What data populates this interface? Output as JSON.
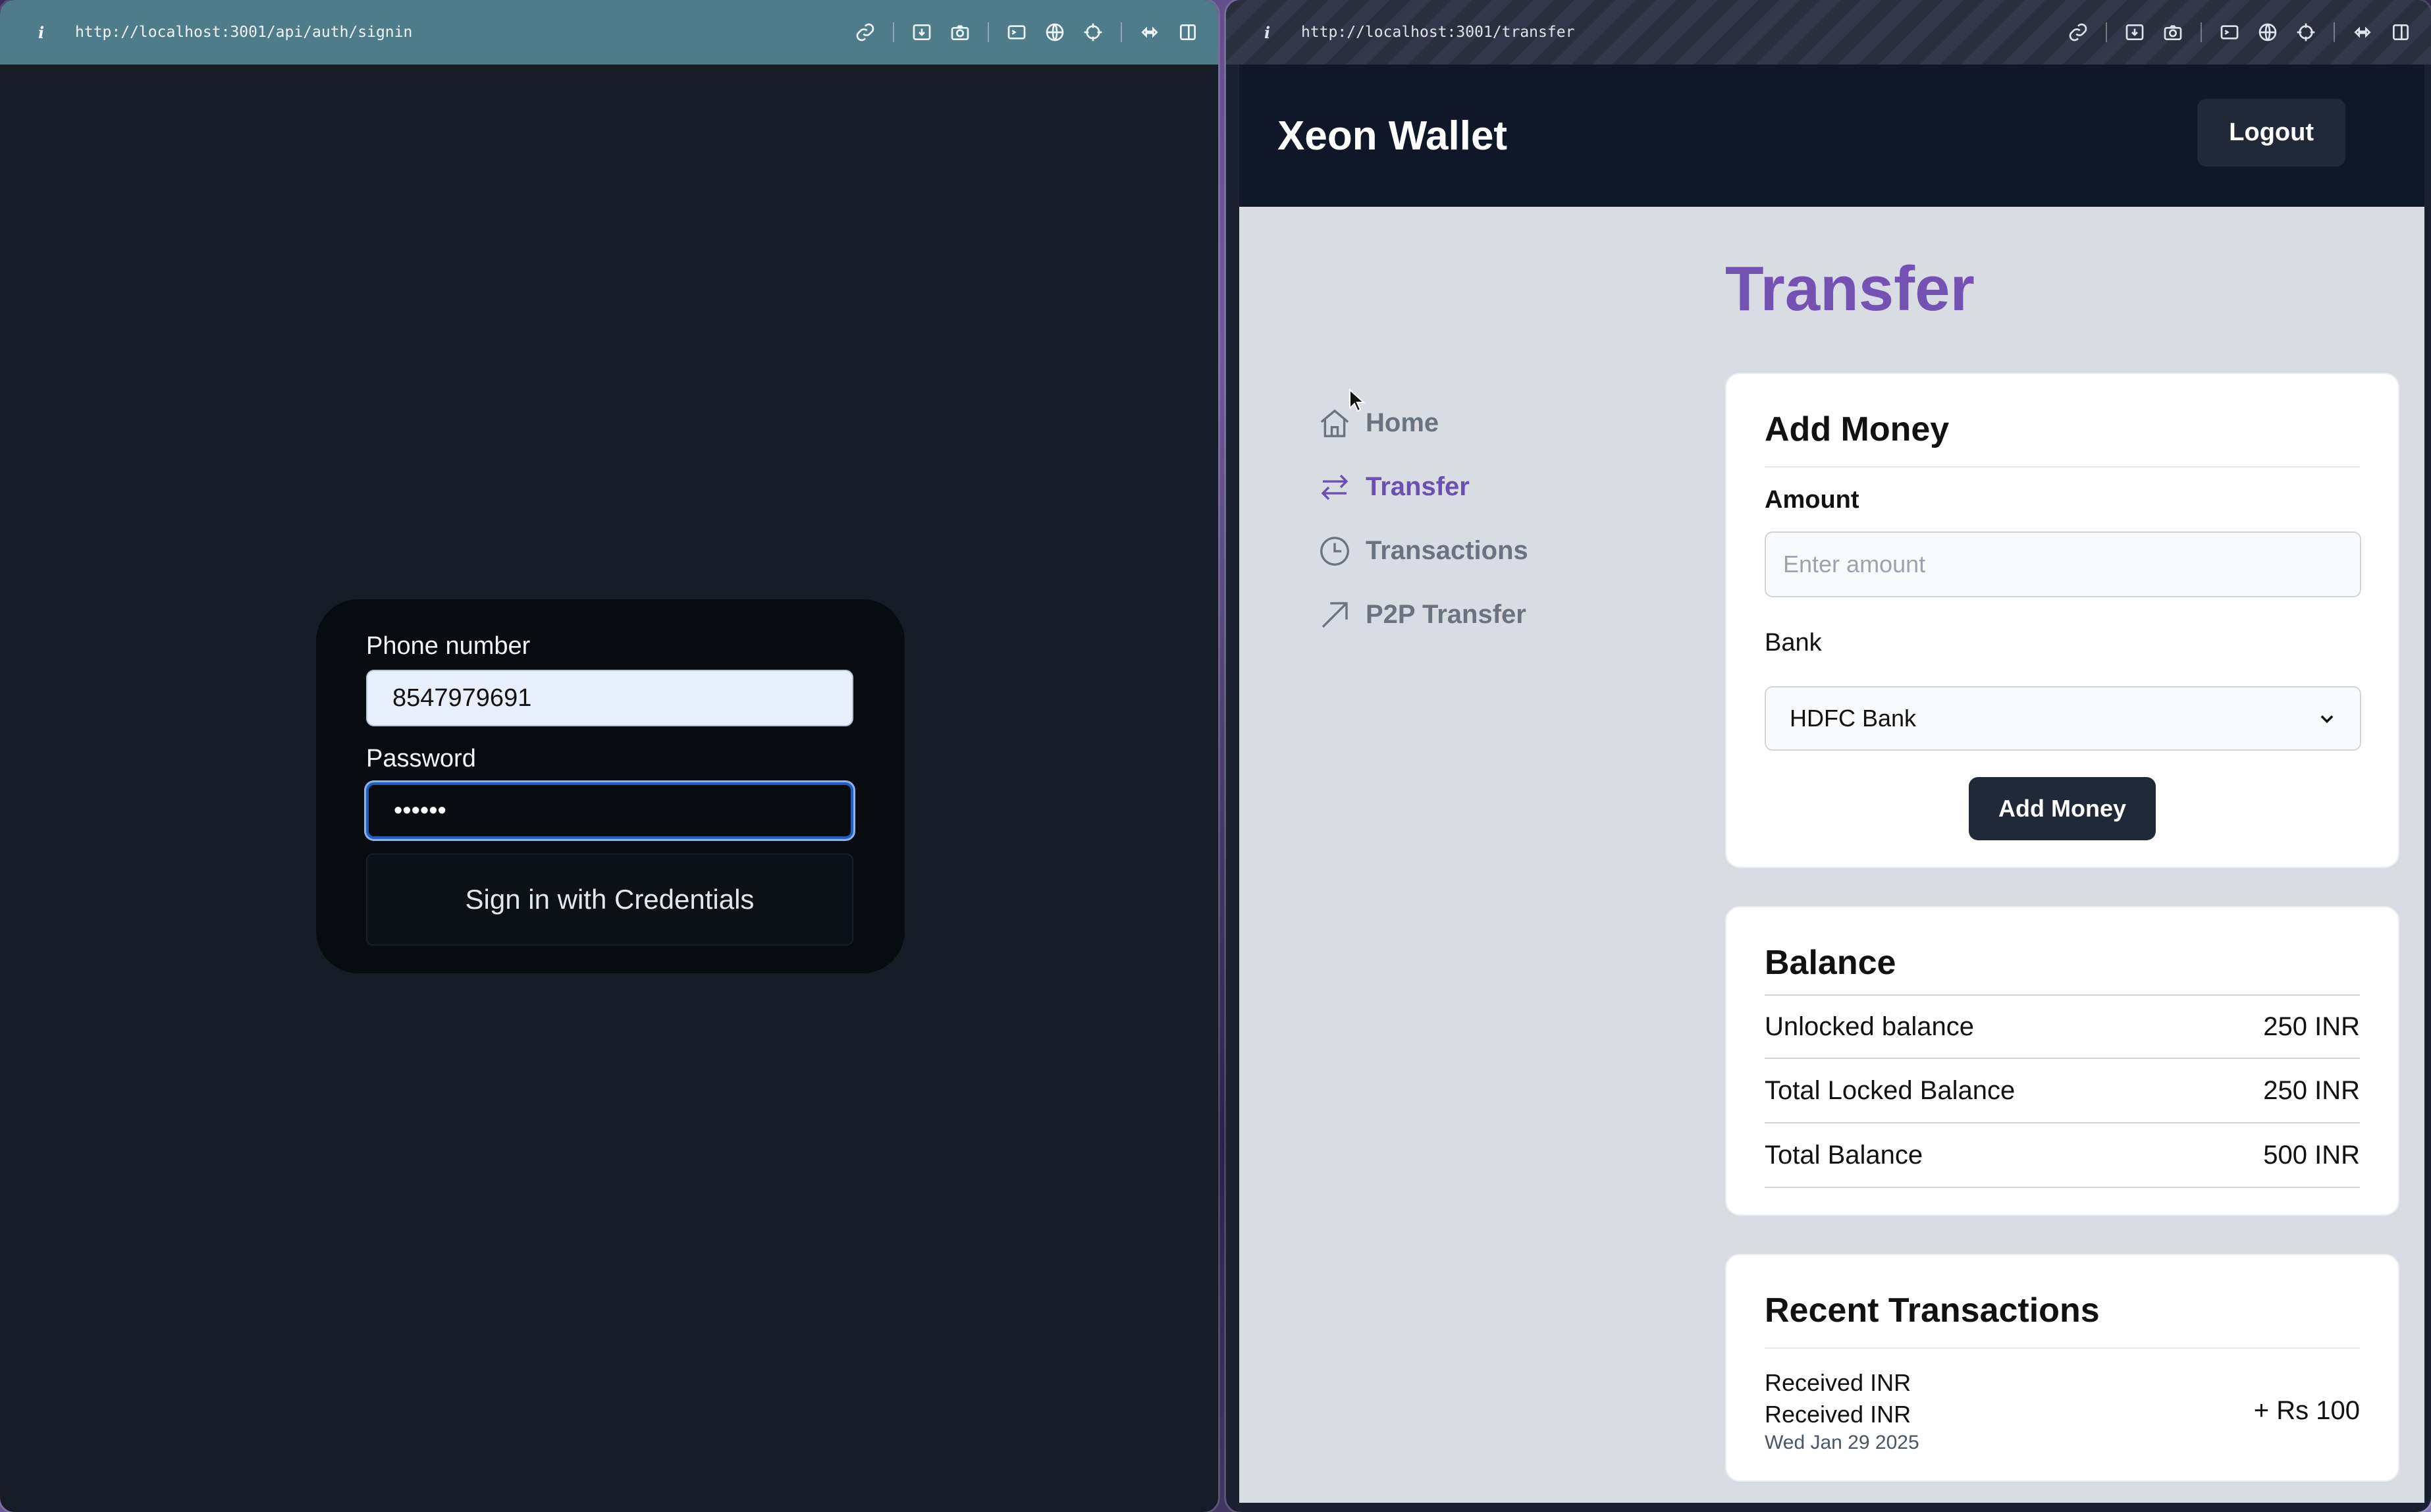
{
  "left_window": {
    "url": "http://localhost:3001/api/auth/signin",
    "form": {
      "phone_label": "Phone number",
      "phone_value": "8547979691",
      "password_label": "Password",
      "password_value": "••••••",
      "submit_label": "Sign in with Credentials"
    }
  },
  "right_window": {
    "url": "http://localhost:3001/transfer",
    "header": {
      "brand": "Xeon Wallet",
      "logout_label": "Logout"
    },
    "sidebar": {
      "items": [
        {
          "label": "Home",
          "icon": "home-icon",
          "active": false
        },
        {
          "label": "Transfer",
          "icon": "transfer-icon",
          "active": true
        },
        {
          "label": "Transactions",
          "icon": "clock-icon",
          "active": false
        },
        {
          "label": "P2P Transfer",
          "icon": "arrow-up-right-icon",
          "active": false
        }
      ]
    },
    "page_title": "Transfer",
    "add_money": {
      "title": "Add Money",
      "amount_label": "Amount",
      "amount_placeholder": "Enter amount",
      "bank_label": "Bank",
      "bank_selected": "HDFC Bank",
      "button_label": "Add Money"
    },
    "balance": {
      "title": "Balance",
      "rows": [
        {
          "label": "Unlocked balance",
          "value": "250 INR"
        },
        {
          "label": "Total Locked Balance",
          "value": "250 INR"
        },
        {
          "label": "Total Balance",
          "value": "500 INR"
        }
      ]
    },
    "recent_transactions": {
      "title": "Recent Transactions",
      "items": [
        {
          "line1": "Received INR",
          "line2": "Received INR",
          "date": "Wed Jan 29 2025",
          "amount": "+ Rs 100"
        }
      ]
    }
  },
  "colors": {
    "accent": "#7352b3",
    "header_bg": "#0f1729",
    "button_bg": "#1f2937"
  }
}
